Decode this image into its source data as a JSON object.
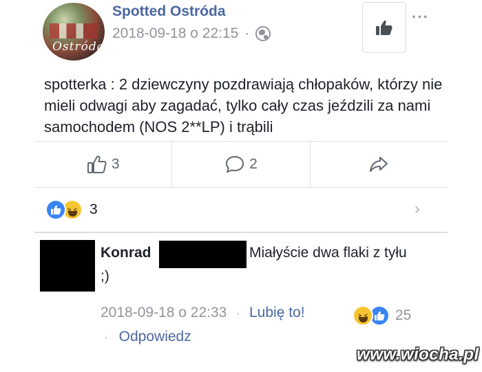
{
  "post": {
    "page_name": "Spotted Ostróda",
    "avatar_mark": "Ostróda",
    "timestamp": "2018-09-18 o 22:15",
    "separator": "·",
    "more": "···",
    "text": "spotterka : 2 dziewczyny pozdrawiają chłopaków, którzy nie mieli odwagi aby zagadać, tylko cały czas jeździli za nami samochodem (NOS 2**LP) i trąbili",
    "actions": {
      "like_count": "3",
      "comment_count": "2"
    },
    "reactions": {
      "count": "3",
      "icons": [
        "like-icon",
        "haha-icon"
      ]
    }
  },
  "comment": {
    "name": "Konrad",
    "text_line1": "Miałyście dwa flaki z tyłu",
    "text_line2": ";)",
    "timestamp": "2018-09-18 o 22:33",
    "separator": "·",
    "like_link": "Lubię to!",
    "reaction_count": "25",
    "reply_link": "Odpowiedz"
  },
  "watermark": "www.wiocha.pl",
  "colors": {
    "link": "#4b67a1",
    "meta": "#90949c",
    "like_blue": "#3b86f7",
    "haha_yellow": "#f7c531"
  }
}
